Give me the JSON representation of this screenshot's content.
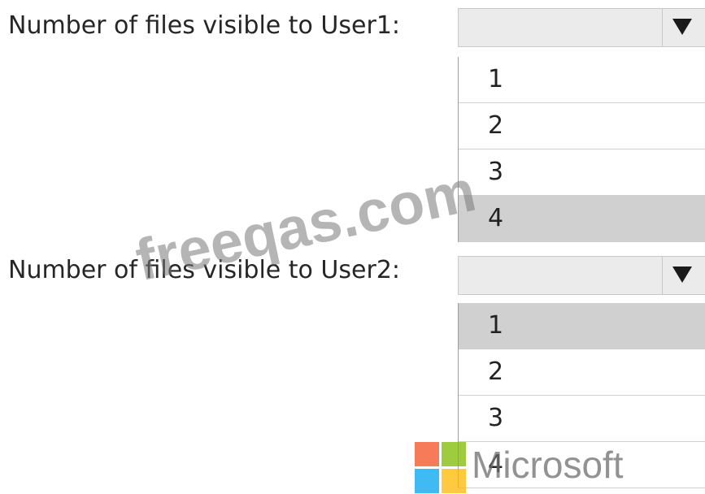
{
  "questions": [
    {
      "label": "Number of files visible to User1:",
      "selected_value": "",
      "options": [
        "1",
        "2",
        "3",
        "4"
      ],
      "highlighted_option": "4"
    },
    {
      "label": "Number of files visible to User2:",
      "selected_value": "",
      "options": [
        "1",
        "2",
        "3",
        "4"
      ],
      "highlighted_option": "1"
    }
  ],
  "watermark": {
    "text": "freeqas.com"
  },
  "logo": {
    "text": "Microsoft",
    "icon": "microsoft-logo-icon",
    "colors": [
      "#f25022",
      "#7fba00",
      "#00a4ef",
      "#ffb900"
    ]
  },
  "colors": {
    "dropdown_bg": "#ebebeb",
    "highlight_bg": "#d0d0d0",
    "text": "#262626"
  }
}
